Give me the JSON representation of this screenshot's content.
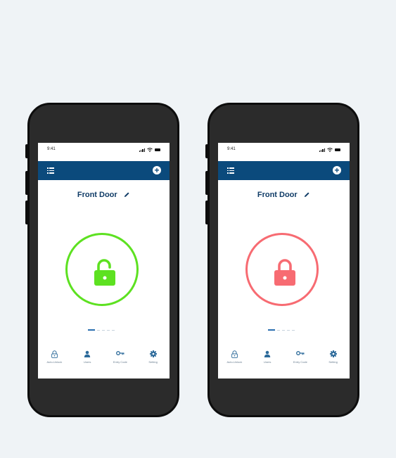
{
  "colors": {
    "background": "#eff3f6",
    "app_bar": "#0b4a7c",
    "title": "#0f3b66",
    "unlocked": "#5de121",
    "locked": "#f76b72",
    "tab_icon": "#2c6a9a"
  },
  "phones": [
    {
      "state": "unlocked",
      "status_bar": {
        "time": "9:41"
      },
      "app_bar": {
        "menu_icon": "list-icon",
        "add_icon": "plus-circle-icon"
      },
      "door_title": "Front Door",
      "edit_icon": "pencil-icon",
      "lock_icon": "unlocked-padlock-icon",
      "pager": {
        "active_index": 0,
        "count": 5
      },
      "tabs": [
        {
          "icon": "lock-outline-icon",
          "label": "Auto-Unlock"
        },
        {
          "icon": "user-icon",
          "label": "Users"
        },
        {
          "icon": "key-icon",
          "label": "Entry Code"
        },
        {
          "icon": "gear-icon",
          "label": "Setting"
        }
      ]
    },
    {
      "state": "locked",
      "status_bar": {
        "time": "9:41"
      },
      "app_bar": {
        "menu_icon": "list-icon",
        "add_icon": "plus-circle-icon"
      },
      "door_title": "Front Door",
      "edit_icon": "pencil-icon",
      "lock_icon": "locked-padlock-icon",
      "pager": {
        "active_index": 0,
        "count": 5
      },
      "tabs": [
        {
          "icon": "lock-outline-icon",
          "label": "Auto-Unlock"
        },
        {
          "icon": "user-icon",
          "label": "Users"
        },
        {
          "icon": "key-icon",
          "label": "Entry Code"
        },
        {
          "icon": "gear-icon",
          "label": "Setting"
        }
      ]
    }
  ]
}
